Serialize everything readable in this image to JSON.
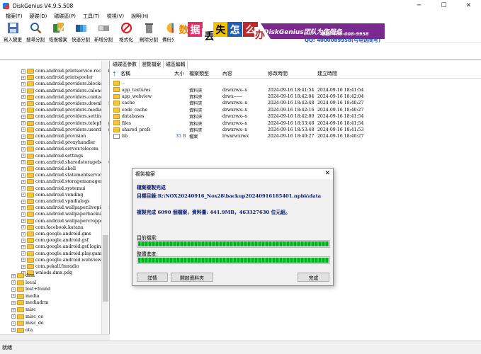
{
  "window": {
    "title": "DiskGenius V4.9.5.508",
    "min": "─",
    "max": "☐",
    "close": "✕"
  },
  "menu": [
    "檔案(F)",
    "硬碟(D)",
    "磁碟區(P)",
    "工具(T)",
    "檢視(V)",
    "說明(H)"
  ],
  "toolbar": [
    {
      "label": "寫入變更",
      "icon": "save-icon"
    },
    {
      "label": "搜尋分割",
      "icon": "search-icon"
    },
    {
      "label": "恢復檔案",
      "icon": "recover-icon"
    },
    {
      "label": "快速分割",
      "icon": "quick-partition-icon"
    },
    {
      "label": "新增分割",
      "icon": "new-partition-icon"
    },
    {
      "label": "格式化",
      "icon": "format-icon"
    },
    {
      "label": "刪除分割",
      "icon": "delete-icon"
    },
    {
      "label": "備份分割",
      "icon": "backup-icon"
    }
  ],
  "banner": {
    "chars": [
      "数",
      "据",
      "丢",
      "失",
      "怎",
      "么",
      "办"
    ],
    "brand": "DiskGenius团队为您服务",
    "tel": "电话: 400-008-9958",
    "qq": "QQ: 4000089958(与电话同号)"
  },
  "tree": [
    "com.android.printservice.recommen",
    "com.android.printspooler",
    "com.android.providers.blockednum",
    "com.android.providers.calendar",
    "com.android.providers.contacts",
    "com.android.providers.downloads",
    "com.android.providers.media",
    "com.android.providers.settings",
    "com.android.providers.telephony",
    "com.android.providers.userdictiona",
    "com.android.provision",
    "com.android.proxyhandler",
    "com.android.server.telecom",
    "com.android.settings",
    "com.android.sharedstoragebackup",
    "com.android.shell",
    "com.android.statementservice",
    "com.android.storagemanager",
    "com.android.systemui",
    "com.android.vending",
    "com.android.vpndialogs",
    "com.android.wallpaper.livepicker",
    "com.android.wallpaperbackup",
    "com.android.wallpapercropper",
    "com.facebook.katana",
    "com.google.android.gms",
    "com.google.android.gsf",
    "com.google.android.gsf.login",
    "com.google.android.play.games",
    "com.google.android.webview",
    "com.pekall.fmradio",
    "wnlods.dmx.pdg"
  ],
  "tree2": [
    "drm",
    "local",
    "lost+found",
    "media",
    "mediadrm",
    "misc",
    "misc_ce",
    "misc_de",
    "ota",
    "ota_package"
  ],
  "tabs": [
    "磁碟區參數",
    "瀏覽檔案",
    "磁區編輯"
  ],
  "columns": {
    "name": "名稱",
    "size": "大小",
    "type": "檔案類型",
    "attr": "內容",
    "modified": "修改時間",
    "created": "建立時間"
  },
  "files": [
    {
      "name": "..",
      "size": "",
      "type": "",
      "attr": "",
      "modified": "",
      "created": ""
    },
    {
      "name": "app_textures",
      "size": "",
      "type": "資料夾",
      "attr": "drwxrwx--x",
      "modified": "2024-09-16 18:41:54",
      "created": "2024-09-16 18:41:54"
    },
    {
      "name": "app_webview",
      "size": "",
      "type": "資料夾",
      "attr": "drwx------",
      "modified": "2024-09-16 18:42:04",
      "created": "2024-09-16 18:42:04"
    },
    {
      "name": "cache",
      "size": "",
      "type": "資料夾",
      "attr": "drwxrwx--x",
      "modified": "2024-09-16 18:42:48",
      "created": "2024-09-16 18:40:27"
    },
    {
      "name": "code_cache",
      "size": "",
      "type": "資料夾",
      "attr": "drwxrwx--x",
      "modified": "2024-09-16 18:42:16",
      "created": "2024-09-16 18:40:27"
    },
    {
      "name": "databases",
      "size": "",
      "type": "資料夾",
      "attr": "drwxrwx--x",
      "modified": "2024-09-16 18:42:00",
      "created": "2024-09-16 18:41:54"
    },
    {
      "name": "files",
      "size": "",
      "type": "資料夾",
      "attr": "drwxrwx--x",
      "modified": "2024-09-16 18:53:46",
      "created": "2024-09-16 18:41:54"
    },
    {
      "name": "shared_prefs",
      "size": "",
      "type": "資料夾",
      "attr": "drwxrwx--x",
      "modified": "2024-09-16 18:53:48",
      "created": "2024-09-16 18:41:53"
    },
    {
      "name": "lib",
      "size": "35 B",
      "type": "檔案",
      "attr": "lrwxrwxrwx",
      "modified": "2024-09-16 18:40:27",
      "created": "2024-09-16 18:40:27"
    }
  ],
  "dialog": {
    "title": "複製檔案",
    "done": "檔案複製完成",
    "target": "目標目錄:R:\\NOX20240916_Nox28\\backup20240916185401.npbk\\data",
    "summary": "複製完成 6090 個檔案，資料量: 441.9MB，463327630 位元組。",
    "current_label": "目前檔案:",
    "overall_label": "整體進度:",
    "current_progress": 100,
    "overall_progress": 100,
    "btn_details": "詳情",
    "btn_open": "開啟資料夾",
    "btn_done": "完成"
  },
  "status": "就緒",
  "colors": {
    "accent": "#1a4fb0",
    "progress": "#06b025",
    "banner": "#7a2a8e"
  }
}
